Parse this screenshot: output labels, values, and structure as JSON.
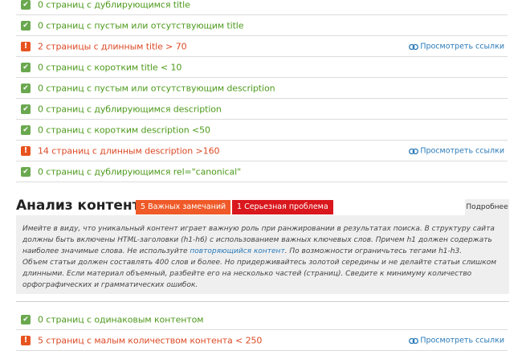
{
  "link_icon": "link-chain-icon",
  "rows_top": [
    {
      "status": "ok",
      "text": "0 страниц с дублирующимся title"
    },
    {
      "status": "ok",
      "text": "0 страниц с пустым или отсутствующим title"
    },
    {
      "status": "warn",
      "text": "2 страницы с длинным title > 70",
      "link": "Просмотреть ссылки"
    },
    {
      "status": "ok",
      "text": "0 страниц с коротким title < 10"
    },
    {
      "status": "ok",
      "text": "0 страниц с пустым или отсутствующим description"
    },
    {
      "status": "ok",
      "text": "0 страниц с дублирующимся description"
    },
    {
      "status": "ok",
      "text": "0 страниц с коротким description <50"
    },
    {
      "status": "warn",
      "text": "14 страниц с длинным description >160",
      "link": "Просмотреть ссылки"
    },
    {
      "status": "ok",
      "text": "0 страниц с дублирующимся rel=\"canonical\""
    }
  ],
  "section": {
    "title": "Анализ контента",
    "badge_important": "5 Важных замечаний",
    "badge_serious": "1 Серьезная проблема",
    "more_label": "Подробнее",
    "desc_line1_pre": "Имейте в виду, что уникальный контент играет важную роль при ранжировании в результатах поиска. В структуру сайта должны быть включены HTML-заголовки (h1-h6) с использованием важных ключевых слов. Причем h1 должен содержать наиболее значимые слова. Не используйте ",
    "desc_link": "повторяющийся контент",
    "desc_line1_post": ". По возможности ограничьтесь тегами h1-h3.",
    "desc_line2": "Объем статьи должен составлять 400 слов и более. Но придерживайтесь золотой середины и не делайте статьи слишком длинными. Если материал объемный, разбейте его на несколько частей (страниц). Сведите к минимуму количество орфографических и грамматических ошибок."
  },
  "rows_bottom": [
    {
      "status": "ok",
      "text": "0 страниц с одинаковым контентом"
    },
    {
      "status": "warn",
      "text": "5 страниц с малым количеством контента < 250",
      "link": "Просмотреть ссылки"
    }
  ],
  "colors": {
    "ok": "#6aa84f",
    "warn": "#e8531f",
    "link": "#2a7ab8",
    "badge_orange": "#ef5a28",
    "badge_red": "#d9171d"
  }
}
